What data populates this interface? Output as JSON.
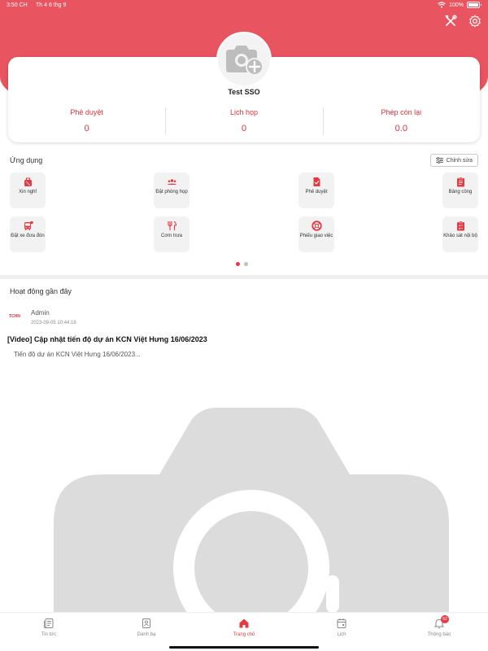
{
  "status_bar": {
    "time": "3:50 CH",
    "date": "Th 4 6 thg 9",
    "battery": "100%"
  },
  "colors": {
    "brand": "#e8545f",
    "accent": "#e23b44",
    "stat_text": "#d8343f"
  },
  "hero_icons": [
    "tools-icon",
    "settings-gear-icon"
  ],
  "profile": {
    "avatar_icon": "camera-add-icon",
    "name": "Test SSO",
    "stats": [
      {
        "label": "Phê duyệt",
        "value": "0"
      },
      {
        "label": "Lịch họp",
        "value": "0"
      },
      {
        "label": "Phép còn lại",
        "value": "0.0"
      }
    ]
  },
  "apps": {
    "title": "Ứng dụng",
    "edit_label": "Chỉnh sửa",
    "items": [
      {
        "label": "Xin nghỉ",
        "icon": "luggage-icon"
      },
      {
        "label": "Đặt phòng họp",
        "icon": "people-group-icon"
      },
      {
        "label": "Phê duyệt",
        "icon": "document-check-icon"
      },
      {
        "label": "Bảng công",
        "icon": "clipboard-list-icon"
      },
      {
        "label": "Đặt xe đưa đón",
        "icon": "bus-icon"
      },
      {
        "label": "Cơm trưa",
        "icon": "food-utensils-icon"
      },
      {
        "label": "Phiếu giao việc",
        "icon": "life-ring-icon"
      },
      {
        "label": "Khảo sát nội bộ",
        "icon": "survey-clipboard-icon"
      }
    ],
    "page_indicator": {
      "pages": 2,
      "active": 1
    }
  },
  "recent": {
    "title": "Hoạt động gần đây",
    "post": {
      "logo_text": "TCHN",
      "author": "Admin",
      "timestamp": "2023-09-05 10:44:18",
      "title": "[Video] Cập nhật tiến độ dự án KCN Việt Hưng 16/06/2023",
      "excerpt": "Tiến độ dự án KCN Việt Hưng 16/06/2023...",
      "image_icon": "image-placeholder-camera-icon"
    }
  },
  "tabbar": {
    "items": [
      {
        "label": "Tin tức",
        "icon": "news-icon",
        "active": false
      },
      {
        "label": "Danh bạ",
        "icon": "contacts-icon",
        "active": false
      },
      {
        "label": "Trang chủ",
        "icon": "home-icon",
        "active": true
      },
      {
        "label": "Lịch",
        "icon": "calendar-icon",
        "active": false
      },
      {
        "label": "Thông báo",
        "icon": "bell-icon",
        "active": false,
        "badge": "62"
      }
    ]
  }
}
